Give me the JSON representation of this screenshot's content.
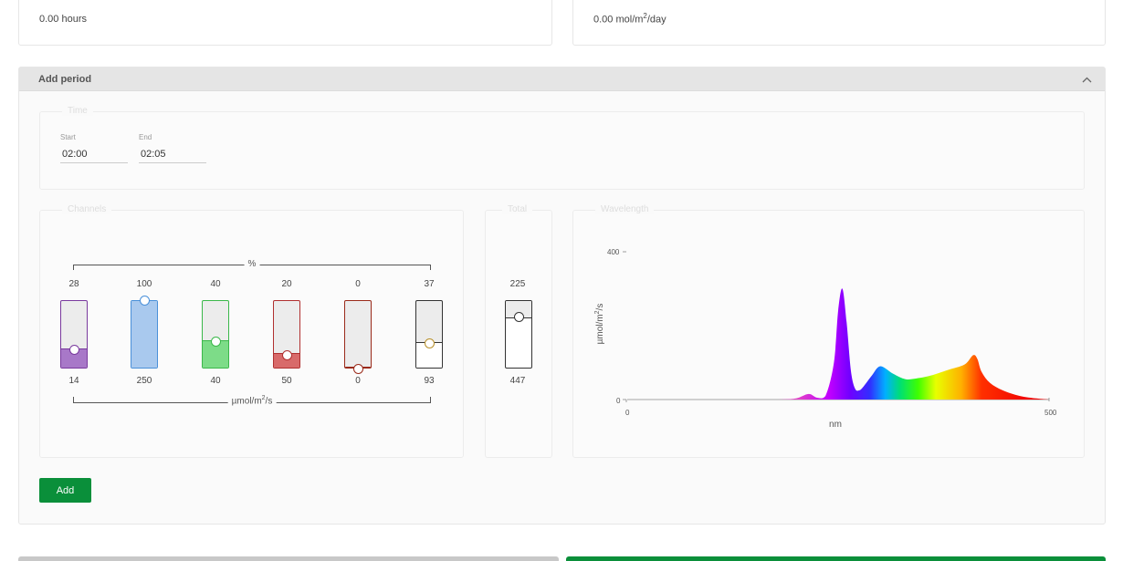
{
  "summary": {
    "hours_value": "0.00 hours",
    "dli_number": "0.00 mol/m",
    "dli_sup": "2",
    "dli_suffix": "/day"
  },
  "panel": {
    "title": "Add period",
    "time": {
      "legend": "Time",
      "start_label": "Start",
      "start_value": "02:00",
      "end_label": "End",
      "end_value": "02:05"
    },
    "channels": {
      "legend": "Channels",
      "percent_label": "%",
      "unit_prefix": "µmol/m",
      "unit_sup": "2",
      "unit_suffix": "/s",
      "items": [
        {
          "percent": "28",
          "value": "14",
          "level": 0.28,
          "color": "#7a3a9e",
          "fill": "#a878c8"
        },
        {
          "percent": "100",
          "value": "250",
          "level": 1.0,
          "color": "#4a90d9",
          "fill": "#a9c9ee"
        },
        {
          "percent": "40",
          "value": "40",
          "level": 0.4,
          "color": "#3bb84a",
          "fill": "#7ddc88"
        },
        {
          "percent": "20",
          "value": "50",
          "level": 0.2,
          "color": "#b03030",
          "fill": "#d86a6a"
        },
        {
          "percent": "0",
          "value": "0",
          "level": 0.0,
          "color": "#9a2a1a",
          "fill": "#d86a6a"
        },
        {
          "percent": "37",
          "value": "93",
          "level": 0.37,
          "color": "#333333",
          "fill": "#ffffff"
        }
      ]
    },
    "total": {
      "legend": "Total",
      "percent": "225",
      "value": "447",
      "level": 0.75
    },
    "wavelength": {
      "legend": "Wavelength",
      "ylabel_prefix": "µmol/m",
      "ylabel_sup": "2",
      "ylabel_suffix": "/s",
      "xlabel": "nm",
      "y_tick_top": "400",
      "y_tick_bottom": "0",
      "x_tick_left": "0",
      "x_tick_right": "500"
    },
    "add_button": "Add"
  },
  "chart_data": {
    "type": "area",
    "title": "",
    "xlabel": "nm",
    "ylabel": "µmol/m²/s",
    "xlim": [
      0,
      500
    ],
    "ylim": [
      0,
      400
    ],
    "x": [
      180,
      200,
      215,
      225,
      235,
      245,
      250,
      255,
      260,
      265,
      270,
      275,
      280,
      290,
      300,
      315,
      330,
      345,
      360,
      380,
      400,
      410,
      415,
      420,
      430,
      445,
      465,
      485,
      500
    ],
    "series": [
      {
        "values": [
          0,
          3,
          15,
          5,
          10,
          100,
          240,
          300,
          210,
          80,
          30,
          25,
          35,
          65,
          90,
          70,
          55,
          58,
          65,
          80,
          95,
          120,
          110,
          75,
          45,
          25,
          10,
          3,
          0
        ]
      }
    ]
  },
  "bottom": {
    "left_color": "#c8c8c8",
    "right_color": "#0a8f3a"
  }
}
